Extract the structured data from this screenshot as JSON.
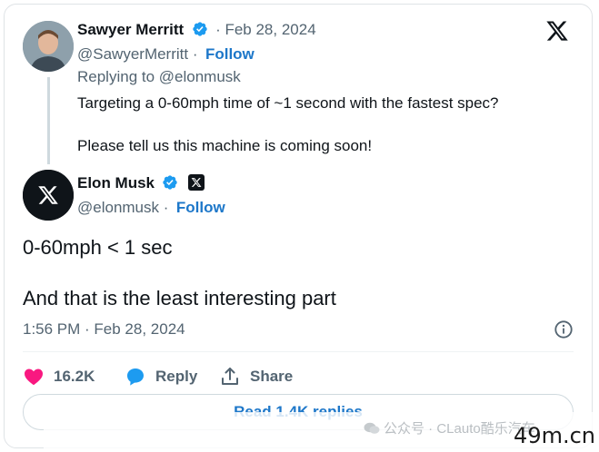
{
  "reply_tweet": {
    "name": "Sawyer Merritt",
    "date": "· Feb 28, 2024",
    "handle": "@SawyerMerritt ·",
    "follow_label": "Follow",
    "replying_to": "Replying to @elonmusk",
    "text_line1": "Targeting a 0-60mph time of ~1 second with the fastest spec?",
    "text_line2": "Please tell us this machine is coming soon!"
  },
  "main_tweet": {
    "name": "Elon Musk",
    "handle": "@elonmusk ·",
    "follow_label": "Follow",
    "text_line1": "0-60mph < 1 sec",
    "text_line2": "And that is the least interesting part",
    "timestamp": "1:56 PM · Feb 28, 2024"
  },
  "actions": {
    "like_count": "16.2K",
    "reply_label": "Reply",
    "share_label": "Share",
    "read_replies_label": "Read 1.4K replies"
  },
  "watermark": {
    "channel": "公众号 · CLauto酷乐汽车",
    "site": "49m.cn"
  },
  "icons": {
    "brand": "x-logo-icon",
    "verified": "verified-badge-icon",
    "like": "heart-icon",
    "reply": "speech-bubble-icon",
    "share": "share-upload-icon",
    "info": "info-icon"
  },
  "colors": {
    "link_blue": "#1d77c9",
    "verified_blue": "#1d9bf0",
    "like_pink": "#f91880",
    "muted_gray": "#536471"
  }
}
